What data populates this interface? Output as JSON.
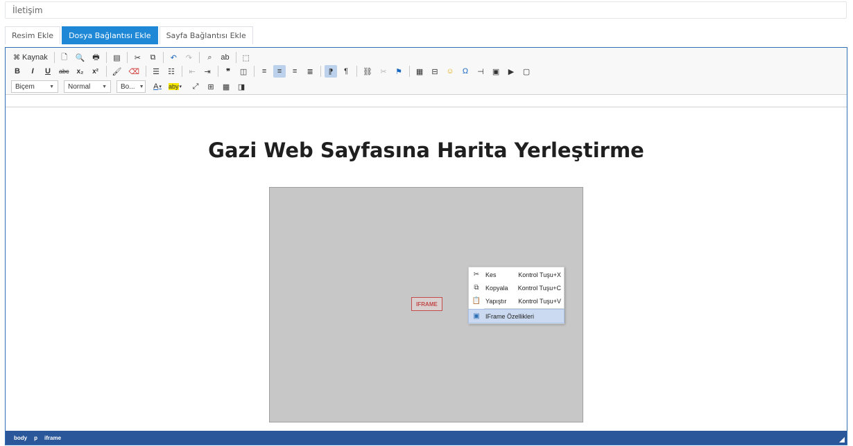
{
  "top_field": {
    "value": "İletişim"
  },
  "tabs": [
    {
      "label": "Resim Ekle",
      "active": false
    },
    {
      "label": "Dosya Bağlantısı Ekle",
      "active": true
    },
    {
      "label": "Sayfa Bağlantısı Ekle",
      "active": false
    }
  ],
  "toolbar": {
    "source_label": "Kaynak",
    "bold": "B",
    "italic": "I",
    "underline": "U",
    "strike": "abc",
    "subscript": "x₂",
    "superscript": "x²",
    "format_combo": "Biçem",
    "style_combo": "Normal",
    "size_combo": "Bo...",
    "font_color": "A",
    "bg_color": "aby"
  },
  "editor": {
    "heading": "Gazi Web Sayfasına Harita Yerleştirme",
    "iframe_placeholder": "IFRAME"
  },
  "context_menu": {
    "items": [
      {
        "label": "Kes",
        "shortcut": "Kontrol Tuşu+X"
      },
      {
        "label": "Kopyala",
        "shortcut": "Kontrol Tuşu+C"
      },
      {
        "label": "Yapıştır",
        "shortcut": "Kontrol Tuşu+V"
      },
      {
        "label": "IFrame Özellikleri",
        "shortcut": ""
      }
    ]
  },
  "statusbar": {
    "path": [
      "body",
      "p",
      "iframe"
    ]
  },
  "colors": {
    "accent": "#1e88d6",
    "statusbar": "#2a579a",
    "highlight": "#cbdaf0"
  }
}
